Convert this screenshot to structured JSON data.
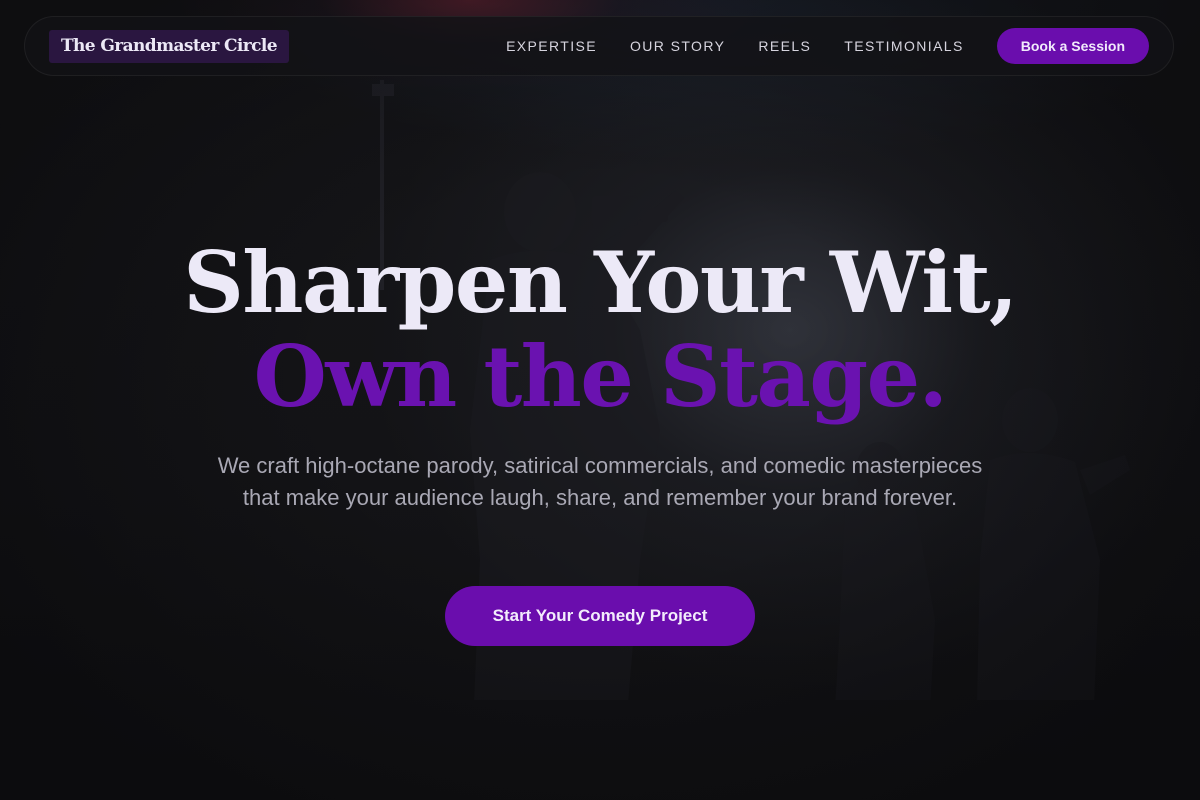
{
  "brand": {
    "logo_text": "The Grandmaster Circle"
  },
  "nav": {
    "links": [
      {
        "label": "EXPERTISE"
      },
      {
        "label": "OUR STORY"
      },
      {
        "label": "REELS"
      },
      {
        "label": "TESTIMONIALS"
      }
    ],
    "book_button": "Book a Session"
  },
  "hero": {
    "headline_line1": "Sharpen Your Wit,",
    "headline_line2": "Own the Stage.",
    "subtext": "We craft high-octane parody, satirical commercials, and comedic masterpieces that make your audience laugh, share, and remember your brand forever.",
    "cta_label": "Start Your Comedy Project",
    "background_image": "stage-performer-silhouette"
  },
  "colors": {
    "accent": "#6a0dad",
    "headline_light": "#ece9f7",
    "headline_accent": "#6a12b0",
    "subtext": "#a9a8b4",
    "background": "#111113"
  }
}
